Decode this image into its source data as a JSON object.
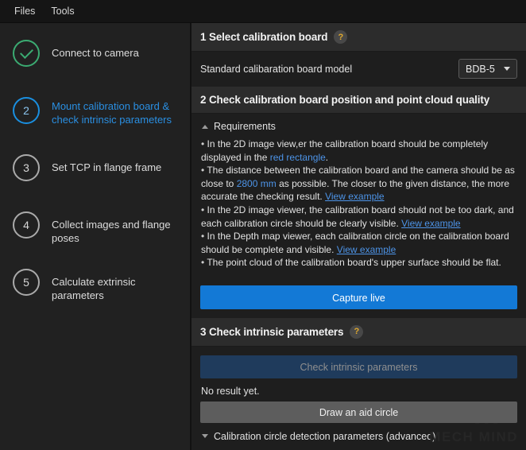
{
  "menubar": {
    "items": [
      {
        "label": "Files",
        "name": "menu-files"
      },
      {
        "label": "Tools",
        "name": "menu-tools"
      }
    ]
  },
  "sidebar": {
    "steps": [
      {
        "number": "1",
        "label": "Connect to camera",
        "state": "done",
        "icon": "check-icon"
      },
      {
        "number": "2",
        "label": "Mount calibration board & check intrinsic parameters",
        "state": "active"
      },
      {
        "number": "3",
        "label": "Set TCP in flange frame",
        "state": "todo"
      },
      {
        "number": "4",
        "label": "Collect images and flange poses",
        "state": "todo"
      },
      {
        "number": "5",
        "label": "Calculate extrinsic parameters",
        "state": "todo"
      }
    ]
  },
  "sections": {
    "section1": {
      "title": "1 Select calibration board",
      "help": "?",
      "field_label": "Standard calibaration board model",
      "combo_value": "BDB-5",
      "combo_options": [
        "BDB-5"
      ]
    },
    "section2": {
      "title": "2 Check calibration board position and point cloud quality",
      "collapser_label": "Requirements",
      "collapser_state": "expanded",
      "requirements": [
        {
          "parts": [
            {
              "t": "text",
              "v": "In the 2D image view,er the calibration board should be completely displayed in the "
            },
            {
              "t": "hl",
              "v": "red rectangle"
            },
            {
              "t": "text",
              "v": "."
            }
          ]
        },
        {
          "parts": [
            {
              "t": "text",
              "v": "The distance between the calibration board and the camera should be as close to "
            },
            {
              "t": "hl",
              "v": "2800 mm"
            },
            {
              "t": "text",
              "v": " as possible. The closer to the given distance, the more accurate the checking result. "
            },
            {
              "t": "link",
              "v": "View example"
            }
          ]
        },
        {
          "parts": [
            {
              "t": "text",
              "v": "In the 2D image viewer, the calibration board should not be too dark, and each calibration circle should be clearly visible. "
            },
            {
              "t": "link",
              "v": "View example"
            }
          ]
        },
        {
          "parts": [
            {
              "t": "text",
              "v": "In the Depth map viewer, each calibration circle on the calibration board should be complete and visible. "
            },
            {
              "t": "link",
              "v": "View example"
            }
          ]
        },
        {
          "parts": [
            {
              "t": "text",
              "v": "The point cloud of the calibration board's upper surface should be flat."
            }
          ]
        }
      ],
      "capture_button": "Capture live"
    },
    "section3": {
      "title": "3 Check intrinsic parameters",
      "help": "?",
      "check_button": "Check intrinsic parameters",
      "check_button_enabled": false,
      "result_text": "No result yet.",
      "aid_circle_button": "Draw an aid circle",
      "advanced_label": "Calibration circle detection parameters (advanced)",
      "advanced_state": "collapsed"
    }
  },
  "watermark": {
    "text": "MECH MIND",
    "mark": "M"
  },
  "colors": {
    "accent_blue": "#1379d6",
    "link_blue": "#4d94e8",
    "success_green": "#3bab72",
    "help_yellow": "#e0a92e",
    "panel_bg": "#1e1e1e",
    "sidebar_bg": "#212121",
    "header_bg": "#2c2c2c"
  }
}
